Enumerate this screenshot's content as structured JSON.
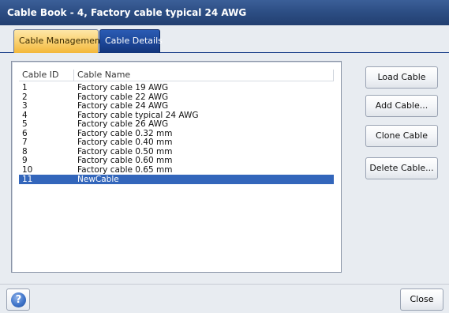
{
  "window": {
    "title": "Cable Book - 4, Factory cable typical 24 AWG"
  },
  "tabs": [
    {
      "label": "Cable Management",
      "active": true
    },
    {
      "label": "Cable Details",
      "active": false
    }
  ],
  "table": {
    "columns": [
      "Cable ID",
      "Cable Name"
    ],
    "rows": [
      {
        "id": "1",
        "name": "Factory cable 19 AWG"
      },
      {
        "id": "2",
        "name": "Factory cable 22 AWG"
      },
      {
        "id": "3",
        "name": "Factory cable 24 AWG"
      },
      {
        "id": "4",
        "name": "Factory cable typical 24 AWG"
      },
      {
        "id": "5",
        "name": "Factory cable 26 AWG"
      },
      {
        "id": "6",
        "name": "Factory cable 0.32 mm"
      },
      {
        "id": "7",
        "name": "Factory cable 0.40 mm"
      },
      {
        "id": "8",
        "name": "Factory cable 0.50 mm"
      },
      {
        "id": "9",
        "name": "Factory cable 0.60 mm"
      },
      {
        "id": "10",
        "name": "Factory cable 0.65 mm"
      },
      {
        "id": "11",
        "name": "NewCable",
        "selected": true
      }
    ]
  },
  "actions": {
    "load": "Load Cable",
    "add": "Add Cable...",
    "clone": "Clone Cable",
    "delete": "Delete Cable..."
  },
  "footer": {
    "help_glyph": "?",
    "close": "Close"
  },
  "colors": {
    "title_bar": "#2c4d83",
    "selection": "#3366bb",
    "active_tab": "#f9cf6d",
    "inactive_tab": "#1b4494"
  }
}
